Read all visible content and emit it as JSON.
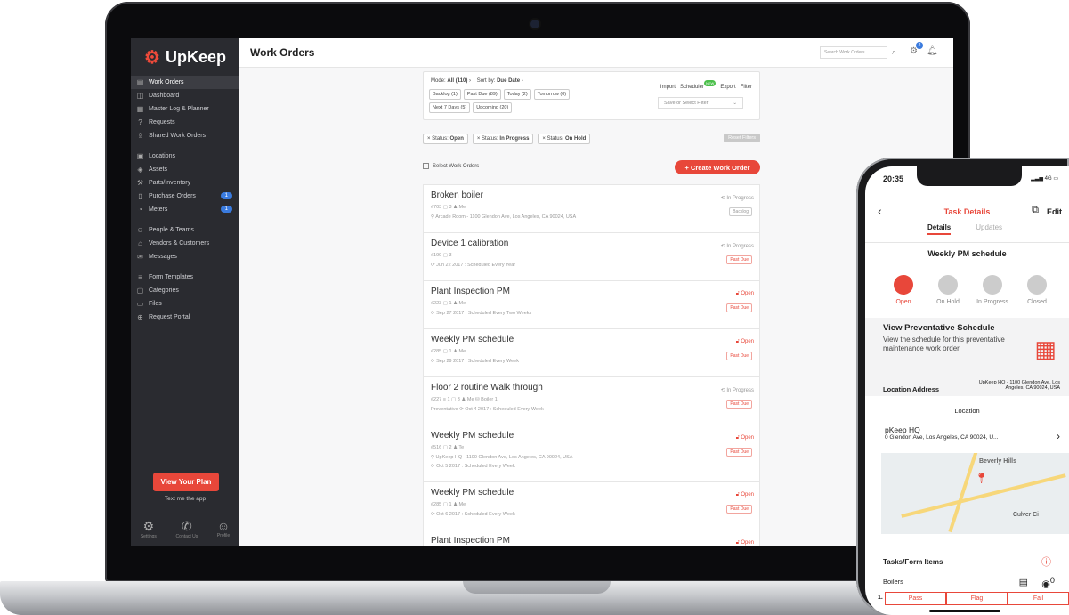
{
  "app": {
    "logo_text": "UpKeep",
    "page_title": "Work Orders"
  },
  "sidebar": {
    "items": [
      {
        "label": "Work Orders",
        "icon": "list-icon",
        "active": true
      },
      {
        "label": "Dashboard",
        "icon": "chart-icon"
      },
      {
        "label": "Master Log & Planner",
        "icon": "calendar-icon"
      },
      {
        "label": "Requests",
        "icon": "question-icon"
      },
      {
        "label": "Shared Work Orders",
        "icon": "share-icon"
      },
      {
        "label": "Locations",
        "icon": "map-icon"
      },
      {
        "label": "Assets",
        "icon": "asset-icon"
      },
      {
        "label": "Parts/Inventory",
        "icon": "wrench-icon"
      },
      {
        "label": "Purchase Orders",
        "icon": "doc-icon",
        "badge": "1"
      },
      {
        "label": "Meters",
        "icon": "meter-icon",
        "badge": "1"
      },
      {
        "label": "People & Teams",
        "icon": "people-icon"
      },
      {
        "label": "Vendors & Customers",
        "icon": "vendor-icon"
      },
      {
        "label": "Messages",
        "icon": "message-icon"
      },
      {
        "label": "Form Templates",
        "icon": "form-icon"
      },
      {
        "label": "Categories",
        "icon": "category-icon"
      },
      {
        "label": "Files",
        "icon": "file-icon"
      },
      {
        "label": "Request Portal",
        "icon": "portal-icon"
      }
    ],
    "plan_button": "View Your Plan",
    "text_app": "Text me the app",
    "footer": [
      "Settings",
      "Contact Us",
      "Profile"
    ]
  },
  "header": {
    "search_placeholder": "Search Work Orders",
    "notif_count": "2"
  },
  "filter": {
    "mode_label": "Mode:",
    "mode_value": "All (110)",
    "sort_label": "Sort by:",
    "sort_value": "Due Date",
    "chips": [
      "Backlog (1)",
      "Past Due (89)",
      "Today (2)",
      "Tomorrow (0)",
      "Next 7 Days (5)",
      "Upcoming (20)"
    ],
    "actions": {
      "import": "Import",
      "scheduler": "Scheduler",
      "new": "NEW",
      "export": "Export",
      "filter": "Filter"
    },
    "save_placeholder": "Save or Select Filter",
    "status_prefix": "Status:",
    "statuses": [
      "Open",
      "In Progress",
      "On Hold"
    ],
    "reset": "Reset Filters",
    "select_label": "Select Work Orders",
    "create": "+ Create Work Order"
  },
  "work_orders": [
    {
      "title": "Broken boiler",
      "meta": "#703  ▢ 3   ♟ Me",
      "detail": "⚲  Arcade Room - 1100 Glendon Ave, Los Angeles, CA 90024, USA",
      "status": "In Progress",
      "tag": "Backlog"
    },
    {
      "title": "Device 1 calibration",
      "meta": "#199  ▢ 3",
      "detail": "⟳  Jun 22 2017  :  Scheduled Every Year",
      "status": "In Progress",
      "tag": "Past Due"
    },
    {
      "title": "Plant Inspection PM",
      "meta": "#223  ▢ 1   ♟ Me",
      "detail": "⟳  Sep 27 2017  :  Scheduled Every Two Weeks",
      "status": "Open",
      "tag": "Past Due"
    },
    {
      "title": "Weekly PM schedule",
      "meta": "#285  ▢ 1   ♟ Me",
      "detail": "⟳  Sep 29 2017  :  Scheduled Every Week",
      "status": "Open",
      "tag": "Past Due"
    },
    {
      "title": "Floor 2 routine Walk through",
      "meta": "#227  ≡ 1   ▢ 3   ♟ Me   ⛁ Boiler 1",
      "detail": "Preventative  ⟳  Oct 4 2017  :  Scheduled Every Week",
      "status": "In Progress",
      "tag": "Past Due"
    },
    {
      "title": "Weekly PM schedule",
      "meta": "#516  ▢ 2   ♟ Te",
      "detail": "⚲  UpKeep HQ - 1100 Glendon Ave, Los Angeles, CA 90024, USA",
      "detail2": "⟳  Oct 5 2017  :  Scheduled Every Week",
      "status": "Open",
      "tag": "Past Due"
    },
    {
      "title": "Weekly PM schedule",
      "meta": "#285  ▢ 1   ♟ Me",
      "detail": "⟳  Oct 6 2017  :  Scheduled Every Week",
      "status": "Open",
      "tag": "Past Due"
    },
    {
      "title": "Plant Inspection PM",
      "meta": "",
      "detail": "",
      "status": "Open",
      "tag": ""
    }
  ],
  "phone": {
    "time": "20:35",
    "signal": "4G",
    "title": "Task Details",
    "edit": "Edit",
    "tabs": [
      "Details",
      "Updates"
    ],
    "subtitle": "Weekly PM schedule",
    "steps": [
      "Open",
      "On Hold",
      "In Progress",
      "Closed"
    ],
    "card_title": "View Preventative Schedule",
    "card_body": "View the schedule for this preventative maintenance work order",
    "loc_label": "Location Address",
    "loc_value": "UpKeep HQ - 1100 Glendon Ave, Los Angeles, CA 90024, USA",
    "location": "Location",
    "map_name": "pKeep HQ",
    "map_addr": "0 Glendon Ave, Los Angeles, CA 90024, U...",
    "map_label1": "Beverly Hills",
    "map_label2": "Culver Ci",
    "tasks_title": "Tasks/Form Items",
    "item_name": "Boilers",
    "item_num": "1.",
    "camera_count": "0",
    "buttons": [
      "Pass",
      "Flag",
      "Fail"
    ]
  },
  "colors": {
    "accent": "#e8473a",
    "sidebar": "#2a2b30",
    "badge": "#3a7bde"
  }
}
